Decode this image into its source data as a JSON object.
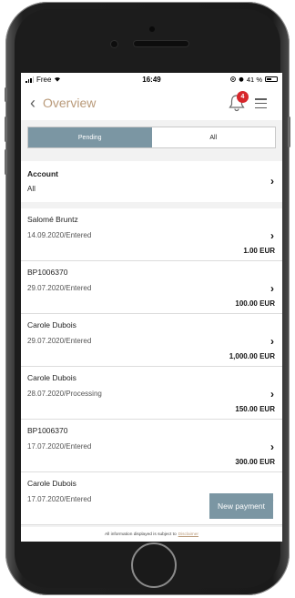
{
  "status_bar": {
    "carrier": "Free",
    "time": "16:49",
    "battery": "41 %"
  },
  "header": {
    "title": "Overview",
    "notification_count": "4"
  },
  "tabs": [
    {
      "label": "Pending",
      "active": true
    },
    {
      "label": "All",
      "active": false
    }
  ],
  "account": {
    "label": "Account",
    "value": "All"
  },
  "transactions": [
    {
      "name": "Salomé Bruntz",
      "meta": "14.09.2020/Entered",
      "amount": "1.00 EUR"
    },
    {
      "name": "BP1006370",
      "meta": "29.07.2020/Entered",
      "amount": "100.00 EUR"
    },
    {
      "name": "Carole Dubois",
      "meta": "29.07.2020/Entered",
      "amount": "1,000.00 EUR"
    },
    {
      "name": "Carole Dubois",
      "meta": "28.07.2020/Processing",
      "amount": "150.00 EUR"
    },
    {
      "name": "BP1006370",
      "meta": "17.07.2020/Entered",
      "amount": "300.00 EUR"
    },
    {
      "name": "Carole Dubois",
      "meta": "17.07.2020/Entered",
      "amount": ""
    }
  ],
  "new_payment_label": "New payment",
  "footer": {
    "text": "All information displayed is subject to",
    "link": "Disclaimer"
  },
  "colors": {
    "accent": "#7b96a3",
    "title": "#b99a7a",
    "badge": "#d7262b"
  }
}
